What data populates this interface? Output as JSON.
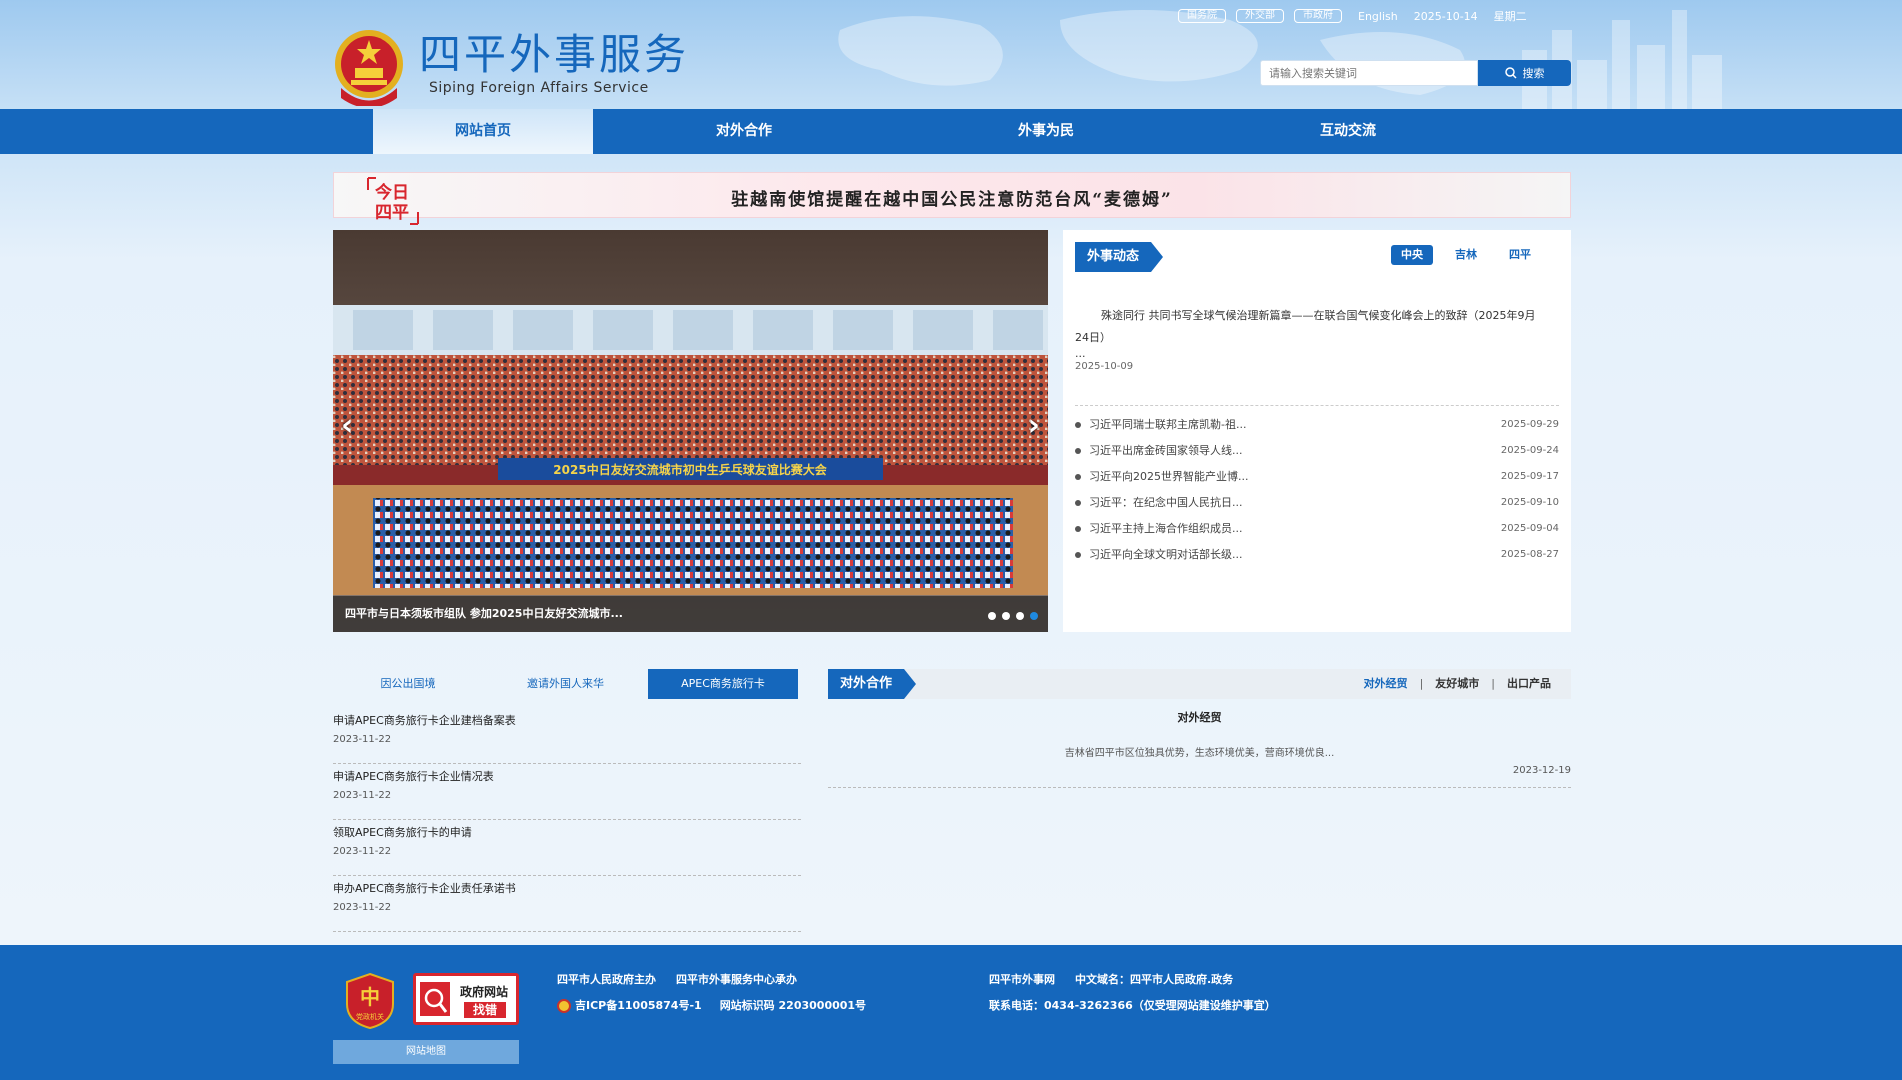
{
  "header": {
    "top_links": [
      "国务院",
      "外交部",
      "市政府"
    ],
    "english": "English",
    "date": "2025-10-14",
    "weekday": "星期二",
    "title_cn": "四平外事服务",
    "title_en": "Siping Foreign Affairs Service",
    "search_placeholder": "请输入搜索关键词",
    "search_button": "搜索"
  },
  "nav": [
    "网站首页",
    "对外合作",
    "外事为民",
    "互动交流"
  ],
  "headline": {
    "badge": "今日四平",
    "text": "驻越南使馆提醒在越中国公民注意防范台风“麦德姆”"
  },
  "slider": {
    "banner_text": "2025中日友好交流城市初中生乒乓球友谊比赛大会",
    "caption": "四平市与日本须坂市组队 参加2025中日友好交流城市...",
    "slide_count": 4,
    "active_slide": 4
  },
  "foreign_news": {
    "title": "外事动态",
    "tabs": [
      "中央",
      "吉林",
      "四平"
    ],
    "active_tab": "中央",
    "featured": {
      "text": "殊途同行 共同书写全球气候治理新篇章——在联合国气候变化峰会上的致辞（2025年9月24日）",
      "ellipsis": "...",
      "date": "2025-10-09"
    },
    "items": [
      {
        "title": "习近平同瑞士联邦主席凯勒-祖...",
        "date": "2025-09-29"
      },
      {
        "title": "习近平出席金砖国家领导人线...",
        "date": "2025-09-24"
      },
      {
        "title": "习近平向2025世界智能产业博...",
        "date": "2025-09-17"
      },
      {
        "title": "习近平：在纪念中国人民抗日...",
        "date": "2025-09-10"
      },
      {
        "title": "习近平主持上海合作组织成员...",
        "date": "2025-09-04"
      },
      {
        "title": "习近平向全球文明对话部长级...",
        "date": "2025-08-27"
      }
    ]
  },
  "services": {
    "tabs": [
      "因公出国境",
      "邀请外国人来华",
      "APEC商务旅行卡"
    ],
    "active_tab": "APEC商务旅行卡",
    "items": [
      {
        "title": "申请APEC商务旅行卡企业建档备案表",
        "date": "2023-11-22"
      },
      {
        "title": "申请APEC商务旅行卡企业情况表",
        "date": "2023-11-22"
      },
      {
        "title": "领取APEC商务旅行卡的申请",
        "date": "2023-11-22"
      },
      {
        "title": "申办APEC商务旅行卡企业责任承诺书",
        "date": "2023-11-22"
      }
    ]
  },
  "cooperation": {
    "title": "对外合作",
    "links": [
      "对外经贸",
      "友好城市",
      "出口产品"
    ],
    "active_link": "对外经贸",
    "subtitle": "对外经贸",
    "desc": "吉林省四平市区位独具优势，生态环境优美，营商环境优良...",
    "date": "2023-12-19"
  },
  "footer": {
    "badge_text": "党政机关",
    "gov_error_line1": "政府网站",
    "gov_error_line2": "找错",
    "sitemap": "网站地图",
    "host": "四平市人民政府主办",
    "organizer": "四平市外事服务中心承办",
    "icp": "吉ICP备11005874号-1",
    "site_code": "网站标识码 2203000001号",
    "site_name": "四平市外事网",
    "domain": "中文域名：四平市人民政府.政务",
    "contact": "联系电话：0434-3262366（仅受理网站建设维护事宜）"
  },
  "colors": {
    "primary": "#1567bc",
    "background": "#eaf3fb",
    "headline_accent": "#d8262e"
  }
}
